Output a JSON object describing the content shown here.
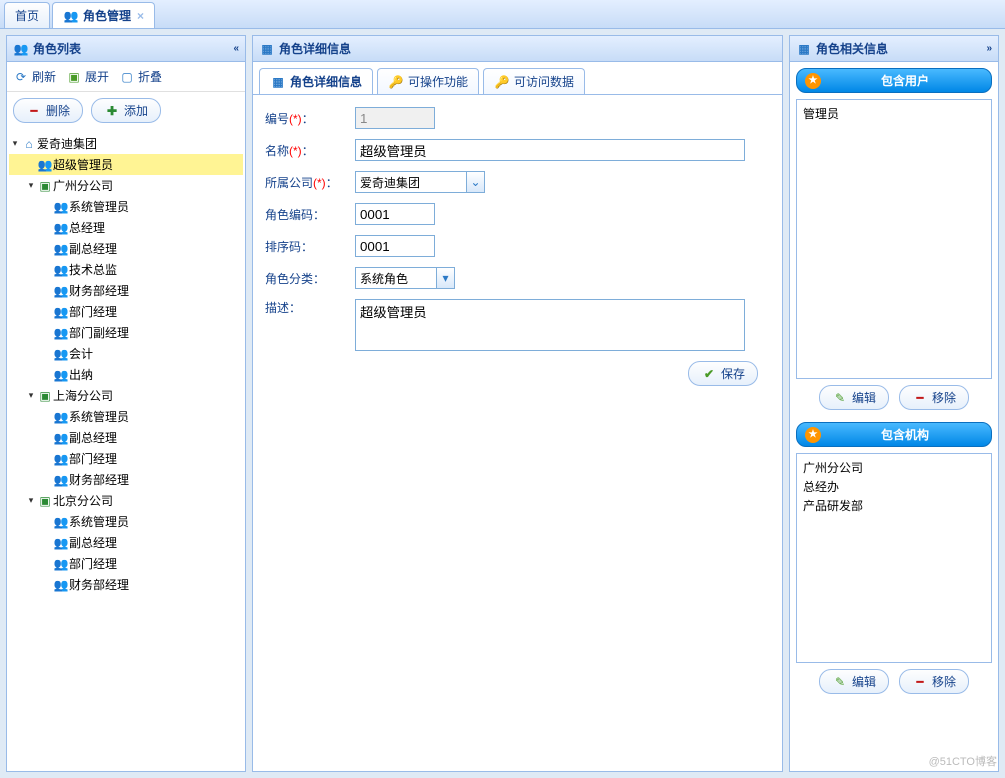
{
  "topTabs": {
    "home": "首页",
    "roleMgmt": "角色管理"
  },
  "west": {
    "title": "角色列表",
    "toolbar": {
      "refresh": "刷新",
      "expand": "展开",
      "collapse": "折叠"
    },
    "buttons": {
      "delete": "删除",
      "add": "添加"
    },
    "tree": {
      "root": "爱奇迪集团",
      "rootChildren": [
        {
          "label": "超级管理员",
          "type": "user",
          "selected": true
        },
        {
          "label": "广州分公司",
          "type": "org",
          "children": [
            "系统管理员",
            "总经理",
            "副总经理",
            "技术总监",
            "财务部经理",
            "部门经理",
            "部门副经理",
            "会计",
            "出纳"
          ]
        },
        {
          "label": "上海分公司",
          "type": "org",
          "children": [
            "系统管理员",
            "副总经理",
            "部门经理",
            "财务部经理"
          ]
        },
        {
          "label": "北京分公司",
          "type": "org",
          "children": [
            "系统管理员",
            "副总经理",
            "部门经理",
            "财务部经理"
          ]
        }
      ]
    }
  },
  "center": {
    "title": "角色详细信息",
    "tabs": {
      "detail": "角色详细信息",
      "functions": "可操作功能",
      "data": "可访问数据"
    },
    "form": {
      "labels": {
        "id": "编号",
        "name": "名称",
        "company": "所属公司",
        "roleCode": "角色编码",
        "sortCode": "排序码",
        "category": "角色分类",
        "desc": "描述："
      },
      "req": "(*)",
      "colon": "：",
      "values": {
        "id": "1",
        "name": "超级管理员",
        "company": "爱奇迪集团",
        "roleCode": "0001",
        "sortCode": "0001",
        "category": "系统角色",
        "desc": "超级管理员"
      },
      "save": "保存"
    }
  },
  "east": {
    "title": "角色相关信息",
    "sections": {
      "users": {
        "head": "包含用户",
        "items": [
          "管理员"
        ],
        "edit": "编辑",
        "remove": "移除"
      },
      "orgs": {
        "head": "包含机构",
        "items": [
          "广州分公司",
          "总经办",
          "产品研发部"
        ],
        "edit": "编辑",
        "remove": "移除"
      }
    }
  },
  "watermark": "@51CTO博客"
}
